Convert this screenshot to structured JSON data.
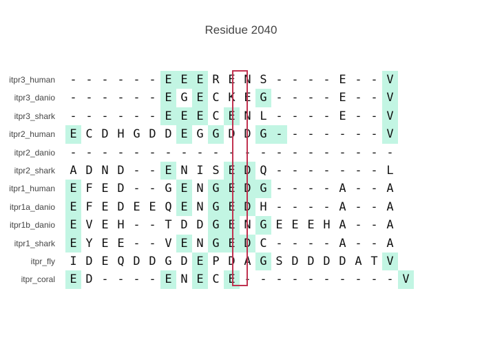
{
  "title": "Residue 2040",
  "colors": {
    "match": "#c2f5e3",
    "highlight_border": "#c0314f"
  },
  "highlight_column_index": 10,
  "sequences": [
    {
      "name": "itpr3_human",
      "residues": "------EEEREN S----E--V",
      "match": "0000001110100000000001"
    },
    {
      "name": "itpr3_danio",
      "residues": "------EGECKEG----E--V",
      "match": "000000101000100000001"
    },
    {
      "name": "itpr3_shark",
      "residues": "------EEECENL----E--V",
      "match": "000000111010000000001"
    },
    {
      "name": "itpr2_human",
      "residues": "ECDHGDDEGGDDG-------V",
      "match": "100000010100110000001"
    },
    {
      "name": "itpr2_danio",
      "residues": "---------------------",
      "match": "000000000000000000000"
    },
    {
      "name": "itpr2_shark",
      "residues": "ADND--ENISEDQ-------L",
      "match": "000000100011000000000"
    },
    {
      "name": "itpr1_human",
      "residues": "EFED--GENGEDG----A--A",
      "match": "100000010111100000000"
    },
    {
      "name": "itpr1a_danio",
      "residues": "EFEDEEQENGEDH----A--A",
      "match": "100000010111000000000"
    },
    {
      "name": "itpr1b_danio",
      "residues": "EVEH--TDDGENGEEEHA--A",
      "match": "100000000110100000000"
    },
    {
      "name": "itpr1_shark",
      "residues": "EYEE--VENGEDC----A--A",
      "match": "100000010111000000000"
    },
    {
      "name": "itpr_fly",
      "residues": "IDEQDDGDEPDAGSDDDDATV",
      "match": "000000001000100000001"
    },
    {
      "name": "itpr_coral",
      "residues": "ED----ENECE----------V",
      "match": "1000001010100000000001"
    }
  ]
}
